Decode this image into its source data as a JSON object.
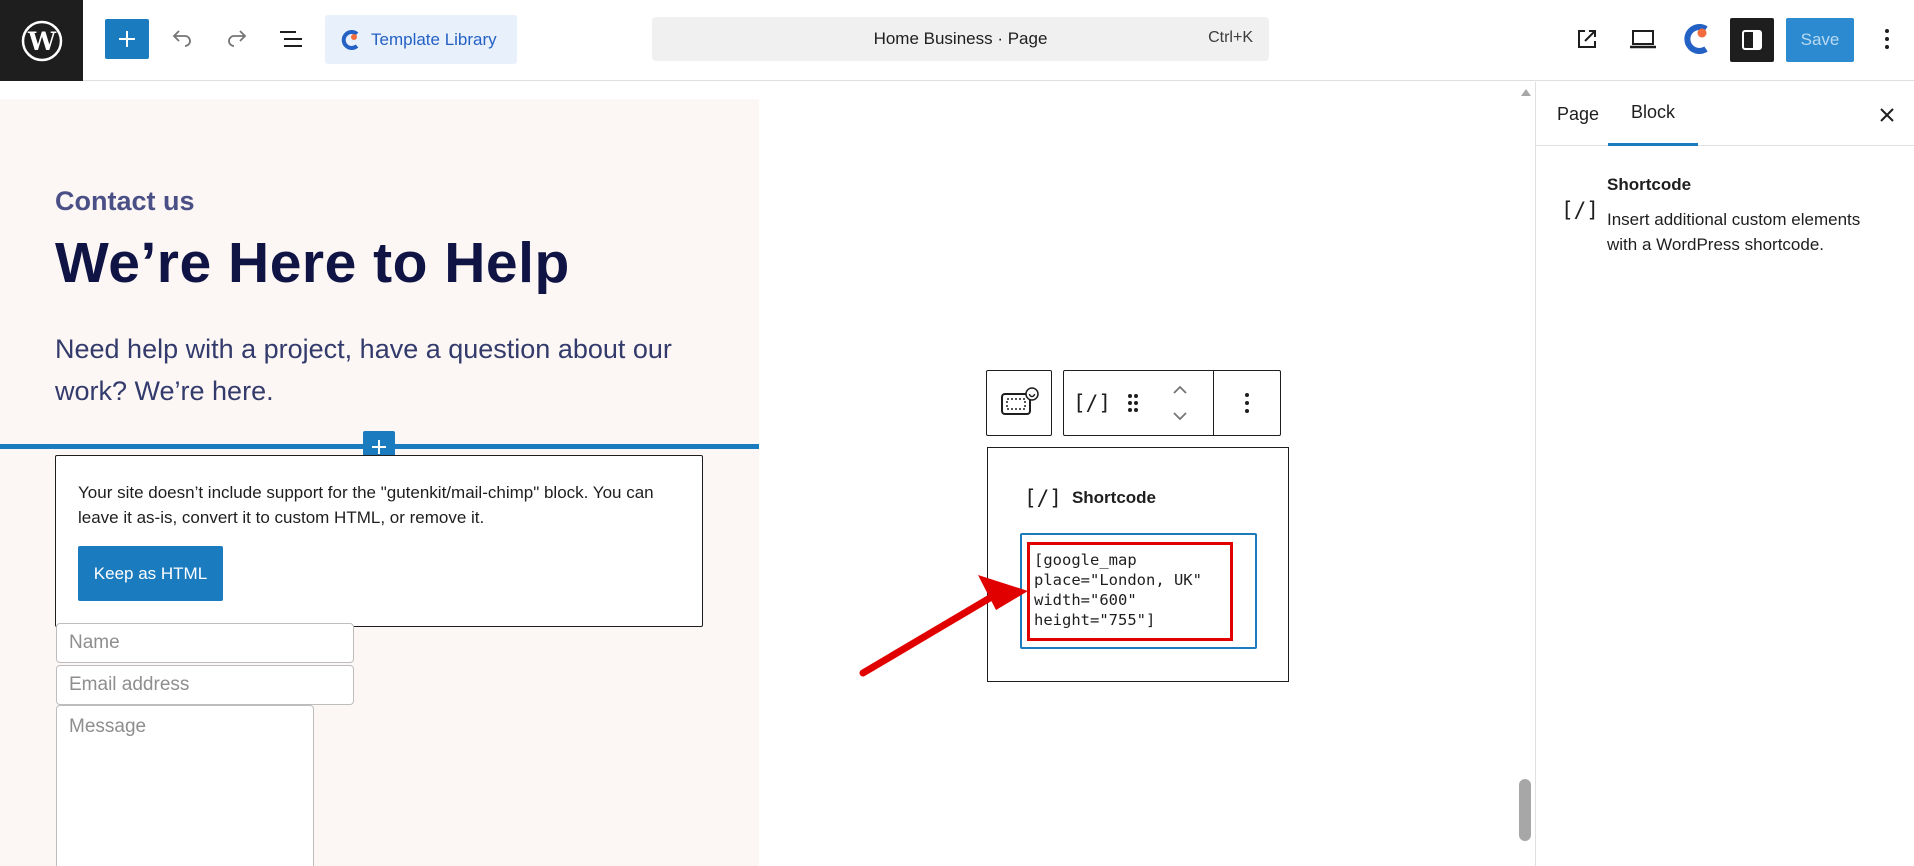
{
  "topbar": {
    "template_library": "Template Library",
    "document_title": "Home Business · Page",
    "shortcut": "Ctrl+K",
    "save": "Save"
  },
  "canvas": {
    "eyebrow": "Contact us",
    "headline": "We’re Here to Help",
    "lead": "Need help with a project, have a question about our work? We’re here.",
    "missing_block_message": "Your site doesn’t include support for the \"gutenkit/mail-chimp\" block. You can leave it as-is, convert it to custom HTML, or remove it.",
    "keep_as_html": "Keep as HTML",
    "form": {
      "name_placeholder": "Name",
      "email_placeholder": "Email address",
      "message_placeholder": "Message"
    },
    "shortcode_block": {
      "label": "Shortcode",
      "icon_glyph": "[/]",
      "code": "[google_map\nplace=\"London, UK\"\nwidth=\"600\"\nheight=\"755\"]"
    }
  },
  "sidebar": {
    "tabs": [
      {
        "label": "Page",
        "active": false
      },
      {
        "label": "Block",
        "active": true
      }
    ],
    "block_card": {
      "icon_glyph": "[/]",
      "title": "Shortcode",
      "description": "Insert additional custom elements with a WordPress shortcode."
    }
  },
  "colors": {
    "accent": "#1a7bbf",
    "headline": "#0f1445",
    "section_bg": "#fcf7f4",
    "annotation": "#e00000"
  }
}
